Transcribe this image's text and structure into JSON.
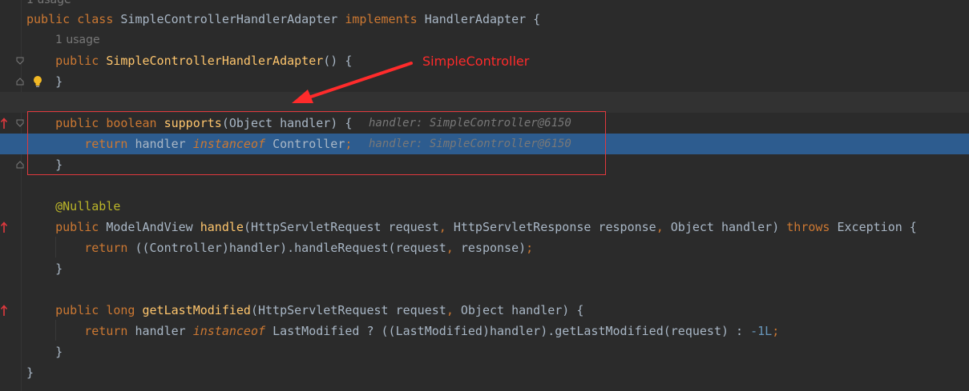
{
  "editor": {
    "usage_top": "1 usage",
    "lines": [
      [
        {
          "t": "public class ",
          "c": "kw"
        },
        {
          "t": "SimpleControllerHandlerAdapter ",
          "c": ""
        },
        {
          "t": "implements ",
          "c": "kw"
        },
        {
          "t": "HandlerAdapter {",
          "c": ""
        }
      ],
      [],
      [
        {
          "t": "    public ",
          "c": "kw"
        },
        {
          "t": "SimpleControllerHandlerAdapter",
          "c": "fn"
        },
        {
          "t": "() {",
          "c": ""
        }
      ],
      [
        {
          "t": "    }",
          "c": ""
        }
      ],
      [],
      [
        {
          "t": "    public boolean ",
          "c": "kw"
        },
        {
          "t": "supports",
          "c": "fn"
        },
        {
          "t": "(Object handler) {",
          "c": ""
        }
      ],
      [
        {
          "t": "        return ",
          "c": "kw"
        },
        {
          "t": "handler ",
          "c": ""
        },
        {
          "t": "instanceof ",
          "c": "kw"
        },
        {
          "t": "Controller",
          "c": ""
        },
        {
          "t": ";",
          "c": "kw"
        }
      ],
      [
        {
          "t": "    }",
          "c": ""
        }
      ],
      [],
      [
        {
          "t": "    @Nullable",
          "c": "ann"
        }
      ],
      [
        {
          "t": "    public ",
          "c": "kw"
        },
        {
          "t": "ModelAndView ",
          "c": ""
        },
        {
          "t": "handle",
          "c": "fn"
        },
        {
          "t": "(HttpServletRequest request",
          "c": ""
        },
        {
          "t": ", ",
          "c": "kw"
        },
        {
          "t": "HttpServletResponse response",
          "c": ""
        },
        {
          "t": ", ",
          "c": "kw"
        },
        {
          "t": "Object handler) ",
          "c": ""
        },
        {
          "t": "throws ",
          "c": "kw"
        },
        {
          "t": "Exception {",
          "c": ""
        }
      ],
      [
        {
          "t": "        return ",
          "c": "kw"
        },
        {
          "t": "((Controller)handler).handleRequest(request",
          "c": ""
        },
        {
          "t": ", ",
          "c": "kw"
        },
        {
          "t": "response)",
          "c": ""
        },
        {
          "t": ";",
          "c": "kw"
        }
      ],
      [
        {
          "t": "    }",
          "c": ""
        }
      ],
      [],
      [
        {
          "t": "    public long ",
          "c": "kw"
        },
        {
          "t": "getLastModified",
          "c": "fn"
        },
        {
          "t": "(HttpServletRequest request",
          "c": ""
        },
        {
          "t": ", ",
          "c": "kw"
        },
        {
          "t": "Object handler) {",
          "c": ""
        }
      ],
      [
        {
          "t": "        return ",
          "c": "kw"
        },
        {
          "t": "handler ",
          "c": ""
        },
        {
          "t": "instanceof ",
          "c": "kw"
        },
        {
          "t": "LastModified ? ((LastModified)handler).getLastModified(request) : ",
          "c": ""
        },
        {
          "t": "-1L",
          "c": "num"
        },
        {
          "t": ";",
          "c": "kw"
        }
      ],
      [
        {
          "t": "    }",
          "c": ""
        }
      ],
      [
        {
          "t": "}",
          "c": ""
        }
      ]
    ],
    "usage_constructor": "1 usage",
    "inlay_supports": "handler: SimpleController@6150",
    "inlay_return": "handler: SimpleController@6150"
  },
  "annotation": {
    "callout_text": "SimpleController",
    "color": "#ff2b2b"
  },
  "colors": {
    "background": "#2b2b2b",
    "keyword": "#cc7832",
    "method": "#ffc66d",
    "annotation": "#bbb529",
    "number": "#6897bb",
    "text": "#a9b7c6",
    "selection": "#2d5c8f"
  }
}
